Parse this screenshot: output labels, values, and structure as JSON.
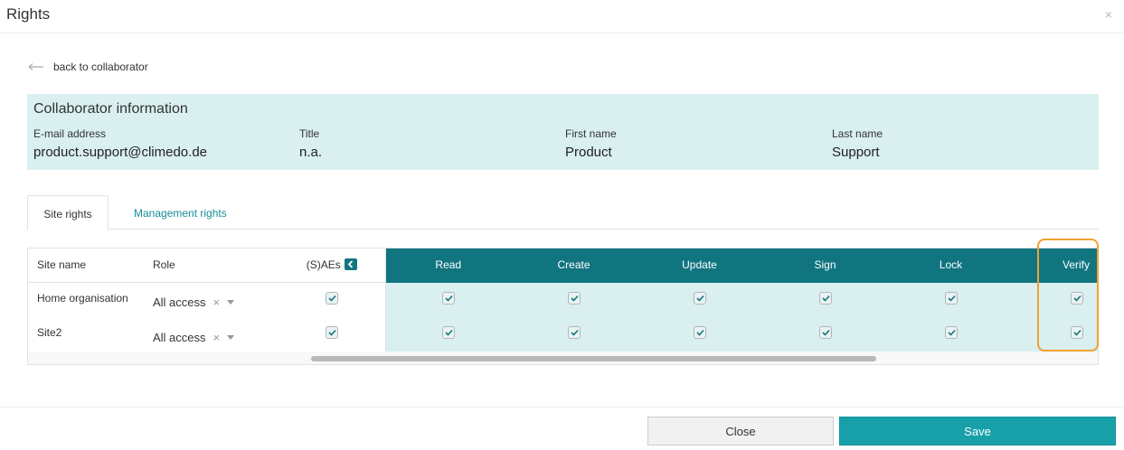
{
  "modal": {
    "title": "Rights",
    "close_glyph": "×"
  },
  "back_link": {
    "label": "back to collaborator"
  },
  "collaborator": {
    "heading": "Collaborator information",
    "email_label": "E-mail address",
    "email": "product.support@climedo.de",
    "title_label": "Title",
    "title": "n.a.",
    "first_name_label": "First name",
    "first_name": "Product",
    "last_name_label": "Last name",
    "last_name": "Support"
  },
  "tabs": [
    {
      "label": "Site rights",
      "active": true
    },
    {
      "label": "Management rights",
      "active": false
    }
  ],
  "table": {
    "headers": {
      "site_name": "Site name",
      "role": "Role",
      "saes": "(S)AEs",
      "read": "Read",
      "create": "Create",
      "update": "Update",
      "sign": "Sign",
      "lock": "Lock",
      "verify": "Verify"
    },
    "rows": [
      {
        "site": "Home organisation",
        "role": "All access",
        "clear_glyph": "×",
        "saes": true,
        "read": true,
        "create": true,
        "update": true,
        "sign": true,
        "lock": true,
        "verify": true
      },
      {
        "site": "Site2",
        "role": "All access",
        "clear_glyph": "×",
        "saes": true,
        "read": true,
        "create": true,
        "update": true,
        "sign": true,
        "lock": true,
        "verify": true
      }
    ]
  },
  "footer": {
    "close_label": "Close",
    "save_label": "Save"
  },
  "colors": {
    "accent": "#117580",
    "info_bg": "#d9eff0",
    "save_button": "#18a0a8",
    "highlight": "#f0a133"
  },
  "icons": {
    "back": "arrow-left-icon",
    "close": "close-icon",
    "collapse": "chevron-left-icon",
    "checkbox": "checkmark-icon",
    "dropdown": "caret-down-icon"
  }
}
